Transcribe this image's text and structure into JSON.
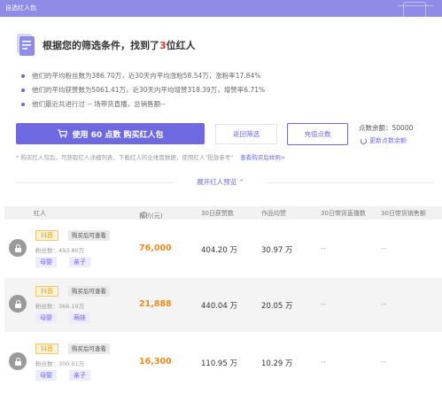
{
  "window": {
    "title": "自选红人包"
  },
  "hero": {
    "title_prefix": "根据您的筛选条件，找到了",
    "count": "3",
    "title_suffix": "位红人"
  },
  "stats": [
    "他们的平均粉丝数为386.70万，近30天内平均涨粉58.54万，涨粉率17.84%",
    "他们的平均获赞数为5061.41万，近30天内平均增赞318.39万，增赞率6.71%",
    "他们最近共进行过 -- 场带货直播，总销售额--"
  ],
  "actions": {
    "use_button": "使用 60 点数 购买红人包",
    "back_button": "返回筛选",
    "recharge_button": "充值点数",
    "balance": "点数余额：50000",
    "refresh": "更新点数余额"
  },
  "note": {
    "text": "* 购买红人包后，可获取红人详细列表，下载红人的全维度数据，使用红人\"投放参考\"",
    "link": "查看购买后样例>"
  },
  "expand_label": "展开红人预览 ⌃",
  "table": {
    "headers": [
      "红人",
      "报价(元)",
      "30日获赞数",
      "作品均赞",
      "30日带货直播数",
      "30日带货销售额"
    ],
    "rows": [
      {
        "platform": "抖音",
        "locked": "购买后可查看",
        "fans": "粉丝数：493.80万",
        "tags": [
          "母婴",
          "亲子"
        ],
        "price": "76,000",
        "likes30": "404.20 万",
        "avg_likes": "30.97 万",
        "live30": "--",
        "sales30": "--"
      },
      {
        "platform": "抖音",
        "locked": "购买后可查看",
        "fans": "粉丝数：366.19万",
        "tags": [
          "母婴",
          "萌娃"
        ],
        "price": "21,888",
        "likes30": "440.04 万",
        "avg_likes": "20.05 万",
        "live30": "--",
        "sales30": "--"
      },
      {
        "platform": "抖音",
        "locked": "购买后可查看",
        "fans": "粉丝数：300.01万",
        "tags": [
          "母婴",
          "亲子"
        ],
        "price": "16,300",
        "likes30": "110.95 万",
        "avg_likes": "10.29 万",
        "live30": "--",
        "sales30": "--"
      }
    ]
  },
  "colors": {
    "accent": "#6e69e0",
    "topbar": "#8f8ce8",
    "price": "#f08a1a",
    "highlight": "#e4342a"
  }
}
